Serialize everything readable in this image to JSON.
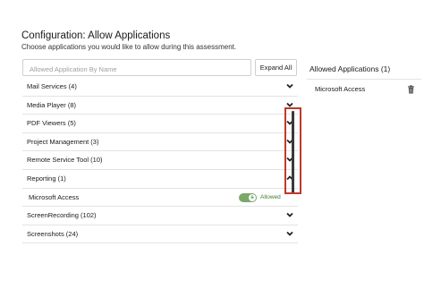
{
  "header": {
    "title": "Configuration: Allow Applications",
    "subtitle": "Choose applications you would like to allow during this assessment."
  },
  "search": {
    "placeholder": "Allowed Application By Name",
    "value": ""
  },
  "expand_all_label": "Expand All",
  "categories": [
    {
      "label": "Mail Services (4)",
      "chevron": "chevron-down-icon"
    },
    {
      "label": "Media Player (8)",
      "chevron": "chevron-down-icon"
    },
    {
      "label": "PDF Viewers (5)",
      "chevron": "chevron-down-icon"
    },
    {
      "label": "Project Management (3)",
      "chevron": "chevron-down-icon"
    },
    {
      "label": "Remote Service Tool (10)",
      "chevron": "chevron-down-icon"
    },
    {
      "label": "Reporting (1)",
      "chevron": "chevron-up-icon"
    },
    {
      "label": "ScreenRecording (102)",
      "chevron": "chevron-down-icon"
    },
    {
      "label": "Screenshots (24)",
      "chevron": "chevron-down-icon"
    }
  ],
  "expanded_item": {
    "label": "Microsoft Access",
    "status_text": "Allowed",
    "toggle_on": true
  },
  "allowed_panel": {
    "title": "Allowed Applications (1)",
    "items": [
      "Microsoft Access"
    ]
  },
  "colors": {
    "toggle_on": "#7aa86a",
    "allowed_text": "#3e7b2e",
    "highlight_border": "#c0392b"
  }
}
